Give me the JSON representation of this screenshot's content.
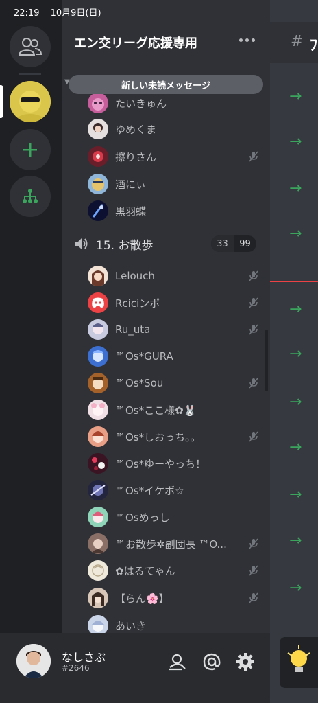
{
  "status": {
    "time": "22:19",
    "date": "10月9日(日)"
  },
  "server": {
    "name": "エン交リーグ応援専用",
    "unread_banner": "新しい未読メッセージ"
  },
  "members_top": [
    {
      "name": "たいきゅん",
      "muted": false
    },
    {
      "name": "ゆめくま",
      "muted": false
    },
    {
      "name": "擦りさん",
      "muted": true
    },
    {
      "name": "酒にぃ",
      "muted": false
    },
    {
      "name": "黒羽蝶",
      "muted": false
    }
  ],
  "voice_channel": {
    "name": "15. お散歩",
    "count": "33",
    "limit": "99"
  },
  "members_vc": [
    {
      "name": "Lelouch",
      "muted": true
    },
    {
      "name": "Rciciンポ",
      "muted": true
    },
    {
      "name": "Ru_uta",
      "muted": true
    },
    {
      "name": "™Os*GURA",
      "muted": false
    },
    {
      "name": "™Os*Sou",
      "muted": true
    },
    {
      "name": "™Os*ここ様✿🐰",
      "muted": false
    },
    {
      "name": "™Os*しおっち。。",
      "muted": true
    },
    {
      "name": "™Os*ゆーやっち！",
      "muted": false
    },
    {
      "name": "™Os*イケボ☆",
      "muted": false
    },
    {
      "name": "™Osめっし",
      "muted": false
    },
    {
      "name": "™お散歩✲副団長 ™O...",
      "muted": true
    },
    {
      "name": "✿はるてゃん",
      "muted": true
    },
    {
      "name": "【らん🌸】",
      "muted": true
    },
    {
      "name": "あいき",
      "muted": false
    }
  ],
  "chat": {
    "channel_name_partial": "ﾌ"
  },
  "user": {
    "name": "なしさぶ",
    "tag": "#2646"
  },
  "colors": {
    "background": "#1f2023",
    "channel_panel": "#2f3136",
    "chat_panel": "#36393f",
    "accent_green": "#3ba55d",
    "danger_red": "#ed4245"
  }
}
